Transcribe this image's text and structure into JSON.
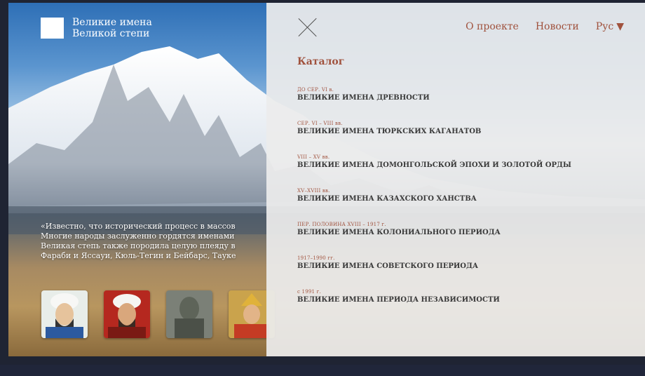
{
  "brand": {
    "line1": "Великие имена",
    "line2": "Великой степи"
  },
  "quote": {
    "lines": [
      "«Известно, что исторический процесс в массов",
      "Многие народы заслуженно гордятся именами",
      "Великая степь также породила целую плеяду в",
      "Фараби и Яссауи, Кюль-Тегин и Бейбарс, Тауке"
    ]
  },
  "nav": {
    "about": "О проекте",
    "news": "Новости",
    "lang": "Рус"
  },
  "catalog": {
    "title": "Каталог",
    "periods": [
      {
        "range": "ДО СЕР. VI в.",
        "name": "ВЕЛИКИЕ ИМЕНА ДРЕВНОСТИ"
      },
      {
        "range": "СЕР. VI – VIII вв.",
        "name": "ВЕЛИКИЕ ИМЕНА ТЮРКСКИХ КАГАНАТОВ"
      },
      {
        "range": "VIII – XV вв.",
        "name": "ВЕЛИКИЕ ИМЕНА ДОМОНГОЛЬСКОЙ ЭПОХИ И ЗОЛОТОЙ ОРДЫ"
      },
      {
        "range": "XV–XVIII вв.",
        "name": "ВЕЛИКИЕ ИМЕНА КАЗАХСКОГО ХАНСТВА"
      },
      {
        "range": "ПЕР. ПОЛОВИНА XVIII – 1917 г.",
        "name": "ВЕЛИКИЕ ИМЕНА КОЛОНИАЛЬНОГО ПЕРИОДА"
      },
      {
        "range": "1917–1990 гг.",
        "name": "ВЕЛИКИЕ ИМЕНА СОВЕТСКОГО ПЕРИОДА"
      },
      {
        "range": "с 1991 г.",
        "name": "ВЕЛИКИЕ ИМЕНА ПЕРИОДА НЕЗАВИСИМОСТИ"
      }
    ]
  },
  "colors": {
    "accent": "#a0523d",
    "overlay": "#ececec",
    "bar": "#20263a"
  },
  "icons": {
    "close": "close-icon",
    "lang_caret": "caret-down-icon"
  }
}
